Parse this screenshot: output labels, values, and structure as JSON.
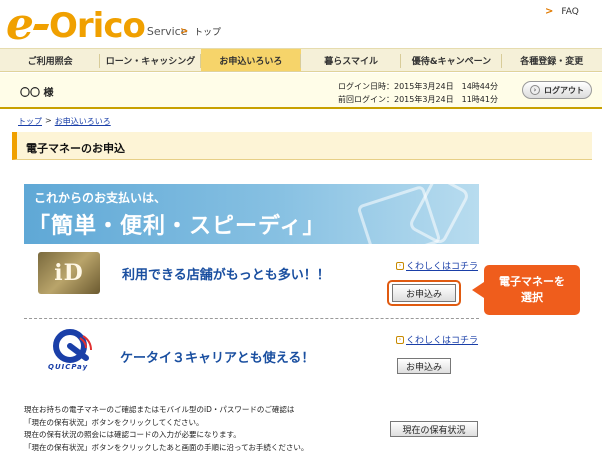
{
  "header": {
    "logo_e": "e",
    "logo_orico": "Orico",
    "logo_service": "Service",
    "breadcrumb_top": "トップ",
    "faq": "FAQ"
  },
  "nav": {
    "items": [
      {
        "label": "ご利用照会"
      },
      {
        "label": "ローン・キャッシング"
      },
      {
        "label": "お申込いろいろ"
      },
      {
        "label": "暮らスマイル"
      },
      {
        "label": "優待&キャンペーン"
      },
      {
        "label": "各種登録・変更"
      }
    ],
    "active_index": 2
  },
  "user": {
    "name": "〇〇 様",
    "login_time": "ログイン日時：2015年3月24日　14時44分",
    "last_login": "前回ログイン：2015年3月24日　11時41分",
    "logout_label": "ログアウト"
  },
  "breadcrumb": {
    "top": "トップ",
    "sep": ">",
    "current": "お申込いろいろ"
  },
  "section": {
    "title": "電子マネーのお申込"
  },
  "banner": {
    "line1": "これからのお支払いは、",
    "line2": "「簡単・便利・スピーディ」"
  },
  "id_row": {
    "logo_text": "iD",
    "headline": "利用できる店舗がもっとも多い！！",
    "more_link": "くわしくはコチラ",
    "apply_label": "お申込み"
  },
  "callout": {
    "line1": "電子マネーを",
    "line2": "選択"
  },
  "quicpay_row": {
    "logo_text": "QUICPay",
    "headline": "ケータイ３キャリアとも使える！",
    "more_link": "くわしくはコチラ",
    "apply_label": "お申込み"
  },
  "note": {
    "lines": [
      "現在お持ちの電子マネーのご確認またはモバイル型のiD・パスワードのご確認は",
      "「現在の保有状況」ボタンをクリックしてください。",
      "現在の保有状況の照会には確認コードの入力が必要になります。",
      "「現在の保有状況」ボタンをクリックしたあと画面の手順に沿ってお手続ください。"
    ],
    "status_button": "現在の保有状況"
  },
  "colors": {
    "brand_orange": "#f0a000",
    "callout": "#ef5d1c",
    "link_blue": "#1a3fa8",
    "headline_blue": "#1a4fa0"
  }
}
